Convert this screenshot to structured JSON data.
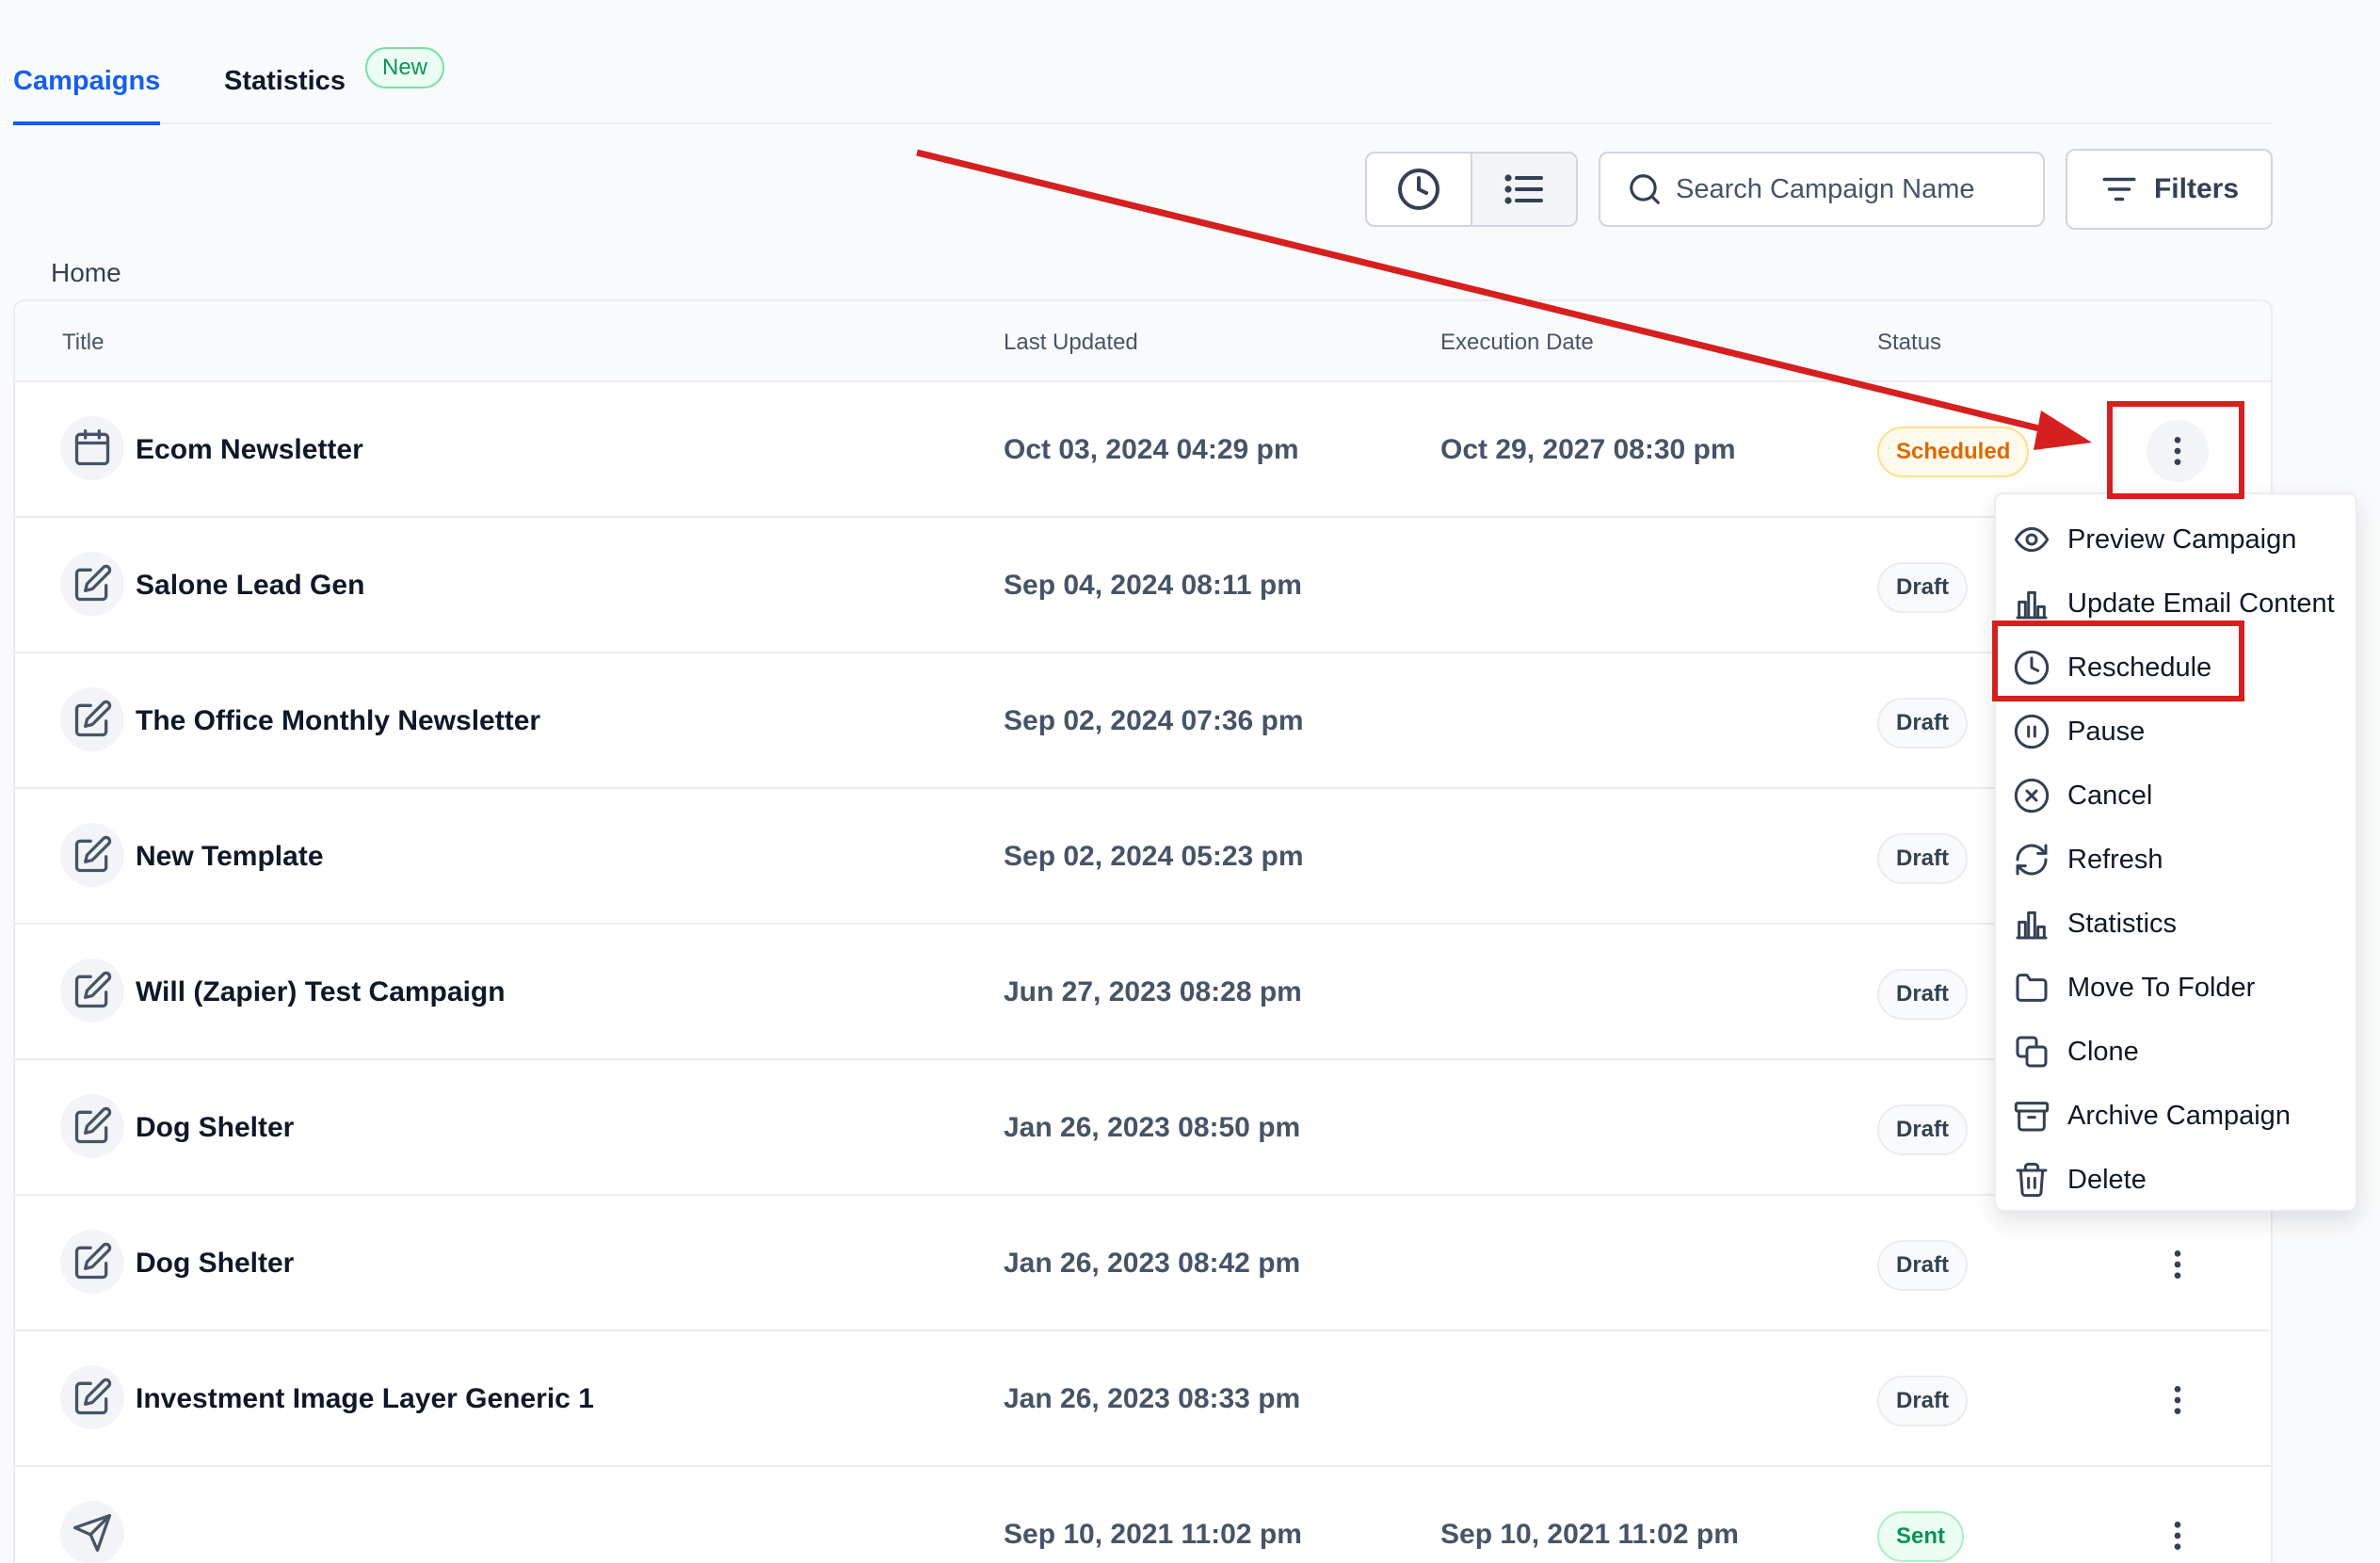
{
  "tabs": [
    {
      "label": "Campaigns"
    },
    {
      "label": "Statistics"
    }
  ],
  "new_badge": "New",
  "search": {
    "placeholder": "Search Campaign Name"
  },
  "filters_label": "Filters",
  "breadcrumb": "Home",
  "table": {
    "columns": [
      "Title",
      "Last Updated",
      "Execution Date",
      "Status"
    ],
    "rows": [
      {
        "icon": "calendar-icon",
        "title": "Ecom Newsletter",
        "updated": "Oct 03, 2024 04:29 pm",
        "execution": "Oct 29, 2027 08:30 pm",
        "status": "Scheduled"
      },
      {
        "icon": "edit-icon",
        "title": "Salone Lead Gen",
        "updated": "Sep 04, 2024 08:11 pm",
        "execution": "",
        "status": "Draft"
      },
      {
        "icon": "edit-icon",
        "title": "The Office Monthly Newsletter",
        "updated": "Sep 02, 2024 07:36 pm",
        "execution": "",
        "status": "Draft"
      },
      {
        "icon": "edit-icon",
        "title": "New Template",
        "updated": "Sep 02, 2024 05:23 pm",
        "execution": "",
        "status": "Draft"
      },
      {
        "icon": "edit-icon",
        "title": "Will (Zapier) Test Campaign",
        "updated": "Jun 27, 2023 08:28 pm",
        "execution": "",
        "status": "Draft"
      },
      {
        "icon": "edit-icon",
        "title": "Dog Shelter",
        "updated": "Jan 26, 2023 08:50 pm",
        "execution": "",
        "status": "Draft"
      },
      {
        "icon": "edit-icon",
        "title": "Dog Shelter",
        "updated": "Jan 26, 2023 08:42 pm",
        "execution": "",
        "status": "Draft"
      },
      {
        "icon": "edit-icon",
        "title": "Investment Image Layer Generic 1",
        "updated": "Jan 26, 2023 08:33 pm",
        "execution": "",
        "status": "Draft"
      },
      {
        "icon": "send-icon",
        "title": "",
        "updated": "Sep 10, 2021 11:02 pm",
        "execution": "Sep 10, 2021 11:02 pm",
        "status": "Sent"
      }
    ]
  },
  "menu": {
    "items": [
      {
        "label": "Preview Campaign",
        "icon": "eye-icon"
      },
      {
        "label": "Update Email Content",
        "icon": "bar-chart-icon"
      },
      {
        "label": "Reschedule",
        "icon": "clock-icon"
      },
      {
        "label": "Pause",
        "icon": "pause-icon"
      },
      {
        "label": "Cancel",
        "icon": "x-circle-icon"
      },
      {
        "label": "Refresh",
        "icon": "refresh-icon"
      },
      {
        "label": "Statistics",
        "icon": "bar-chart-icon"
      },
      {
        "label": "Move To Folder",
        "icon": "folder-icon"
      },
      {
        "label": "Clone",
        "icon": "copy-icon"
      },
      {
        "label": "Archive Campaign",
        "icon": "archive-icon"
      },
      {
        "label": "Delete",
        "icon": "trash-icon"
      }
    ]
  },
  "colors": {
    "accent": "#155eef",
    "annotation": "#d61f1f",
    "scheduled": "#dc6803",
    "sent": "#079455"
  }
}
